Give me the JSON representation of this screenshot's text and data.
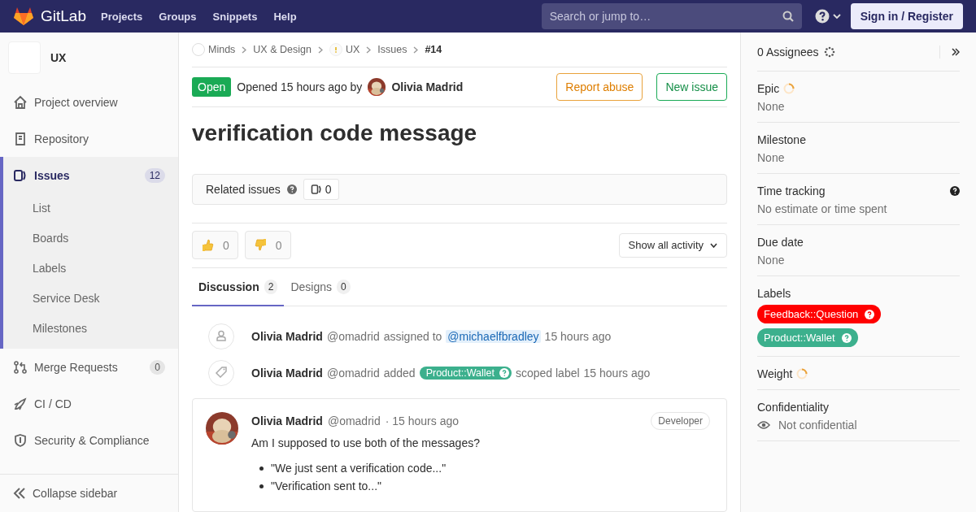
{
  "header": {
    "brand": "GitLab",
    "nav": [
      "Projects",
      "Groups",
      "Snippets",
      "Help"
    ],
    "search": {
      "placeholder": "Search or jump to…"
    },
    "sign_in": "Sign in / Register"
  },
  "sidebar": {
    "project": "UX",
    "items": [
      {
        "kind": "overview",
        "label": "Project overview",
        "selected": false
      },
      {
        "kind": "repository",
        "label": "Repository",
        "selected": false
      },
      {
        "kind": "issues",
        "label": "Issues",
        "count": "12",
        "selected": true,
        "expanded": true,
        "children": [
          {
            "label": "List"
          },
          {
            "label": "Boards"
          },
          {
            "label": "Labels"
          },
          {
            "label": "Service Desk"
          },
          {
            "label": "Milestones"
          }
        ]
      },
      {
        "kind": "merge",
        "label": "Merge Requests",
        "count": "0",
        "selected": false
      },
      {
        "kind": "cicd",
        "label": "CI / CD",
        "selected": false
      },
      {
        "kind": "security",
        "label": "Security & Compliance",
        "selected": false
      }
    ],
    "collapse": "Collapse sidebar"
  },
  "breadcrumbs": [
    {
      "kind": "group",
      "label": "Minds"
    },
    {
      "kind": "plain",
      "label": "UX & Design"
    },
    {
      "kind": "project",
      "label": "UX"
    },
    {
      "kind": "plain",
      "label": "Issues"
    },
    {
      "kind": "current",
      "label": "#14"
    }
  ],
  "issue": {
    "status": "Open",
    "opened": "Opened 15 hours ago by",
    "author": "Olivia Madrid",
    "actions": [
      {
        "kind": "warning",
        "label": "Report abuse"
      },
      {
        "kind": "success",
        "label": "New issue"
      }
    ],
    "title": "verification code message",
    "related": {
      "label": "Related issues",
      "count": "0"
    },
    "awards": [
      {
        "kind": "up",
        "count": "0"
      },
      {
        "kind": "down",
        "count": "0"
      }
    ],
    "activity_filter": "Show all activity",
    "tabs": [
      {
        "label": "Discussion",
        "count": "2",
        "selected": true
      },
      {
        "label": "Designs",
        "count": "0",
        "selected": false
      }
    ],
    "notes": [
      {
        "kind": "assigned",
        "author": "Olivia Madrid",
        "handle": "@omadrid",
        "action": "assigned to",
        "mention": "@michaelfbradley",
        "time": "15 hours ago"
      },
      {
        "kind": "labeled",
        "author": "Olivia Madrid",
        "handle": "@omadrid",
        "action": "added",
        "label": {
          "text": "Product::Wallet",
          "color": "#3cb08d"
        },
        "after": "scoped label",
        "time": "15 hours ago"
      },
      {
        "kind": "comment",
        "author": "Olivia Madrid",
        "handle": "@omadrid",
        "time": "· 15 hours ago",
        "role": "Developer",
        "body": "Am I supposed to use both of the messages?",
        "bullets": [
          "\"We just sent a verification code...\"",
          "\"Verification sent to...\""
        ]
      }
    ]
  },
  "right_sidebar": {
    "assignees": "0 Assignees",
    "blocks": [
      {
        "kind": "loading",
        "title": "Epic",
        "value": "None"
      },
      {
        "kind": "value",
        "title": "Milestone",
        "value": "None"
      },
      {
        "kind": "help",
        "title": "Time tracking",
        "value": "No estimate or time spent"
      },
      {
        "kind": "value",
        "title": "Due date",
        "value": "None"
      },
      {
        "kind": "labels",
        "title": "Labels",
        "labels": [
          {
            "text": "Feedback::Question",
            "color": "#ff0000"
          },
          {
            "text": "Product::Wallet",
            "color": "#3cb08d"
          }
        ]
      },
      {
        "kind": "loading",
        "title": "Weight"
      },
      {
        "kind": "confidential",
        "title": "Confidentiality",
        "value": "Not confidential"
      }
    ]
  }
}
